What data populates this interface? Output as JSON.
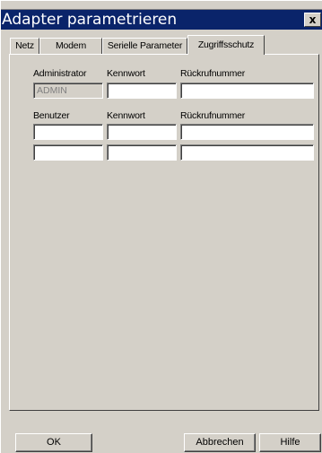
{
  "window": {
    "title": "Adapter parametrieren",
    "close_label": "x"
  },
  "tabs": [
    {
      "label": "Netz"
    },
    {
      "label": "Modem"
    },
    {
      "label": "Serielle Parameter"
    },
    {
      "label": "Zugriffsschutz",
      "active": true
    }
  ],
  "admin": {
    "col_user": "Administrator",
    "col_password": "Kennwort",
    "col_callback": "Rückrufnummer",
    "user_value": "ADMIN",
    "password_value": "",
    "callback_value": ""
  },
  "users": {
    "col_user": "Benutzer",
    "col_password": "Kennwort",
    "col_callback": "Rückrufnummer",
    "rows": [
      {
        "user": "",
        "password": "",
        "callback": ""
      },
      {
        "user": "",
        "password": "",
        "callback": ""
      }
    ]
  },
  "buttons": {
    "ok": "OK",
    "cancel": "Abbrechen",
    "help": "Hilfe"
  }
}
